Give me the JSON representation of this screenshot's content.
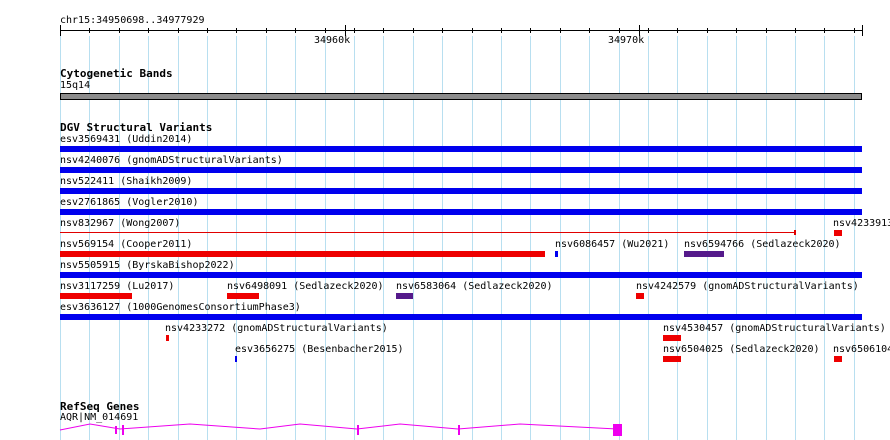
{
  "ruler": {
    "location": "chr15:34950698..34977929",
    "ticks": [
      "34960k",
      "34970k"
    ]
  },
  "cytoband": {
    "title": "Cytogenetic Bands",
    "band": "15q14"
  },
  "dgv": {
    "title": "DGV Structural Variants",
    "colors": {
      "blue": "#0000ee",
      "red": "#ee0000",
      "purple": "#551a8b",
      "thin_red": "#e00000"
    },
    "features": [
      "esv3569431 (Uddin2014)",
      "nsv4240076 (gnomADStructuralVariants)",
      "nsv522411 (Shaikh2009)",
      "esv2761865 (Vogler2010)",
      "nsv832967 (Wong2007)",
      "nsv4233913",
      "nsv569154 (Cooper2011)",
      "nsv6086457 (Wu2021)",
      "nsv6594766 (Sedlazeck2020)",
      "nsv5505915 (ByrskaBishop2022)",
      "nsv3117259 (Lu2017)",
      "nsv6498091 (Sedlazeck2020)",
      "nsv6583064 (Sedlazeck2020)",
      "nsv4242579 (gnomADStructuralVariants)",
      "esv3636127 (1000GenomesConsortiumPhase3)",
      "nsv4233272 (gnomADStructuralVariants)",
      "nsv4530457 (gnomADStructuralVariants)",
      "esv3656275 (Besenbacher2015)",
      "nsv6504025 (Sedlazeck2020)",
      "nsv6506104"
    ]
  },
  "refseq": {
    "title": "RefSeq Genes",
    "gene": "AQR|NM_014691",
    "color": "#ee00ee"
  }
}
